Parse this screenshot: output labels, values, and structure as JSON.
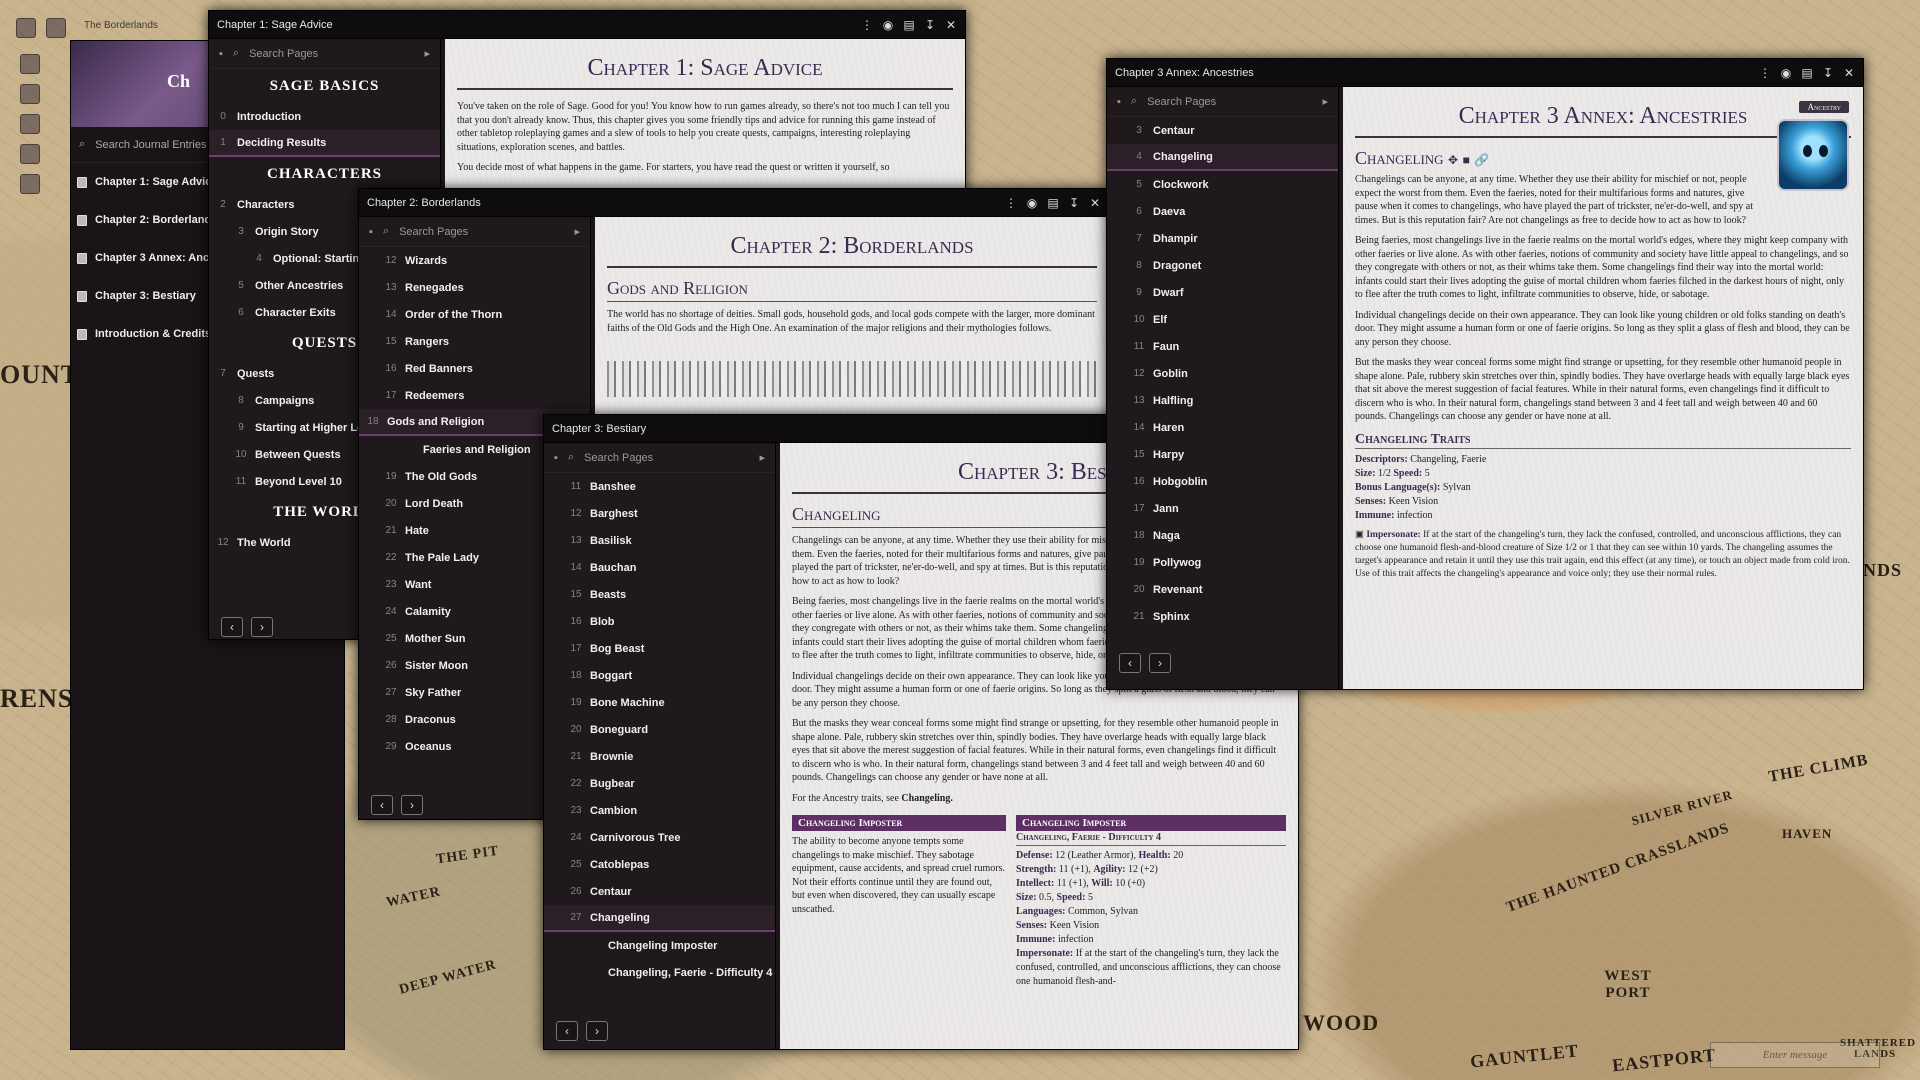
{
  "map": {
    "labels": [
      "OUNT",
      "RENS",
      "THE PIT",
      "WATER",
      "DEEP WATER",
      "N WOOD",
      "GAUNTLET",
      "EASTPORT",
      "WEST PORT",
      "THE HAUNTED CRASSLANDS",
      "SILVER RIVER",
      "HAVEN",
      "THE CLIMB",
      "LANDS",
      "SHATTERED LANDS"
    ]
  },
  "chat": {
    "placeholder": "Enter message"
  },
  "journal": {
    "search_placeholder": "Search Journal Entries",
    "entries": [
      "Chapter 1: Sage Advice",
      "Chapter 2: Borderlands",
      "Chapter 3 Annex: Ancestries",
      "Chapter 3: Bestiary",
      "Introduction & Credits"
    ],
    "banner_title": "Ch",
    "tab_title": "The Borderlands"
  },
  "w1": {
    "title": "Chapter 1: Sage Advice",
    "search": "Search Pages",
    "sections": [
      {
        "heading": "Sage Basics",
        "items": [
          {
            "n": "0",
            "label": "Introduction"
          },
          {
            "n": "1",
            "label": "Deciding Results"
          }
        ]
      },
      {
        "heading": "Characters",
        "items": [
          {
            "n": "2",
            "label": "Characters"
          },
          {
            "n": "3",
            "label": "Origin Story"
          },
          {
            "n": "4",
            "label": "Optional: Starting T"
          },
          {
            "n": "5",
            "label": "Other Ancestries"
          },
          {
            "n": "6",
            "label": "Character Exits"
          }
        ]
      },
      {
        "heading": "Quests",
        "items": [
          {
            "n": "7",
            "label": "Quests"
          },
          {
            "n": "8",
            "label": "Campaigns"
          },
          {
            "n": "9",
            "label": "Starting at Higher Lev"
          },
          {
            "n": "10",
            "label": "Between Quests"
          },
          {
            "n": "11",
            "label": "Beyond Level 10"
          }
        ]
      },
      {
        "heading": "The World",
        "items": [
          {
            "n": "12",
            "label": "The World"
          }
        ]
      }
    ],
    "page_title": "Chapter 1: Sage Advice",
    "p1": "You've taken on the role of Sage. Good for you! You know how to run games already, so there's not too much I can tell you that you don't already know. Thus, this chapter gives you some friendly tips and advice for running this game instead of other tabletop roleplaying games and a slew of tools to help you create quests, campaigns, interesting roleplaying situations, exploration scenes, and battles.",
    "p2": "You decide most of what happens in the game. For starters, you have read the quest or written it yourself, so"
  },
  "w2": {
    "title": "Chapter 2: Borderlands",
    "search": "Search Pages",
    "items": [
      {
        "n": "12",
        "label": "Wizards"
      },
      {
        "n": "13",
        "label": "Renegades"
      },
      {
        "n": "14",
        "label": "Order of the Thorn"
      },
      {
        "n": "15",
        "label": "Rangers"
      },
      {
        "n": "16",
        "label": "Red Banners"
      },
      {
        "n": "17",
        "label": "Redeemers"
      },
      {
        "n": "18",
        "label": "Gods and Religion"
      },
      {
        "n": "",
        "label": "Faeries and Religion"
      },
      {
        "n": "19",
        "label": "The Old Gods"
      },
      {
        "n": "20",
        "label": "Lord Death"
      },
      {
        "n": "21",
        "label": "Hate"
      },
      {
        "n": "22",
        "label": "The Pale Lady"
      },
      {
        "n": "23",
        "label": "Want"
      },
      {
        "n": "24",
        "label": "Calamity"
      },
      {
        "n": "25",
        "label": "Mother Sun"
      },
      {
        "n": "26",
        "label": "Sister Moon"
      },
      {
        "n": "27",
        "label": "Sky Father"
      },
      {
        "n": "28",
        "label": "Draconus"
      },
      {
        "n": "29",
        "label": "Oceanus"
      }
    ],
    "page_title": "Chapter 2: Borderlands",
    "h2": "Gods and Religion",
    "p1": "The world has no shortage of deities. Small gods, household gods, and local gods compete with the larger, more dominant faiths of the Old Gods and the High One. An examination of the major religions and their mythologies follows."
  },
  "w3": {
    "title": "Chapter 3: Bestiary",
    "search": "Search Pages",
    "items": [
      {
        "n": "11",
        "label": "Banshee"
      },
      {
        "n": "12",
        "label": "Barghest"
      },
      {
        "n": "13",
        "label": "Basilisk"
      },
      {
        "n": "14",
        "label": "Bauchan"
      },
      {
        "n": "15",
        "label": "Beasts"
      },
      {
        "n": "16",
        "label": "Blob"
      },
      {
        "n": "17",
        "label": "Bog Beast"
      },
      {
        "n": "18",
        "label": "Boggart"
      },
      {
        "n": "19",
        "label": "Bone Machine"
      },
      {
        "n": "20",
        "label": "Boneguard"
      },
      {
        "n": "21",
        "label": "Brownie"
      },
      {
        "n": "22",
        "label": "Bugbear"
      },
      {
        "n": "23",
        "label": "Cambion"
      },
      {
        "n": "24",
        "label": "Carnivorous Tree"
      },
      {
        "n": "25",
        "label": "Catoblepas"
      },
      {
        "n": "26",
        "label": "Centaur"
      },
      {
        "n": "27",
        "label": "Changeling"
      },
      {
        "n": "",
        "label": "Changeling Imposter"
      },
      {
        "n": "",
        "label": "Changeling, Faerie - Difficulty 4"
      }
    ],
    "page_title": "Chapter 3: Bestia",
    "h2": "Changeling",
    "p1": "Changelings can be anyone, at any time. Whether they use their ability for mischief or not, people expect the worst from them. Even the faeries, noted for their multifarious forms and natures, give pause when it comes to changelings, who have played the part of trickster, ne'er-do-well, and spy at times. But is this reputation fair? Are not changelings as free to decide how to act as how to look?",
    "p2": "Being faeries, most changelings live in the faerie realms on the mortal world's edges, where they might keep company with other faeries or live alone. As with other faeries, notions of community and society have little appeal to changelings, and so they congregate with others or not, as their whims take them. Some changelings find their way into the mortal world: infants could start their lives adopting the guise of mortal children whom faeries filched in the darkest hours of night, only to flee after the truth comes to light, infiltrate communities to observe, hide, or sabotage.",
    "p3": "Individual changelings decide on their own appearance. They can look like young children or old folks standing on death's door. They might assume a human form or one of faerie origins. So long as they split a glass of flesh and blood, they can be any person they choose.",
    "p4": "But the masks they wear conceal forms some might find strange or upsetting, for they resemble other humanoid people in shape alone. Pale, rubbery skin stretches over thin, spindly bodies. They have overlarge heads with equally large black eyes that sit above the merest suggestion of facial features. While in their natural forms, even changelings find it difficult to discern who is who. In their natural form, changelings stand between 3 and 4 feet tall and weigh between 40 and 60 pounds. Changelings can choose any gender or have none at all.",
    "p5a": "For the Ancestry traits, see ",
    "p5b": "Changeling.",
    "box1_title": "Changeling Imposter",
    "box1_text": "The ability to become anyone tempts some changelings to make mischief. They sabotage equipment, cause accidents, and spread cruel rumors. Not their efforts continue until they are found out, but even when discovered, they can usually escape unscathed.",
    "box2_title": "Changeling Imposter",
    "box2_sub": "Changeling, Faerie - Difficulty 4",
    "stats": [
      {
        "k": "Defense:",
        "v": " 12 (Leather Armor), "
      },
      {
        "k": "Health:",
        "v": " 20"
      },
      {
        "k": "Strength:",
        "v": " 11 (+1), "
      },
      {
        "k": "Agility:",
        "v": " 12 (+2)"
      },
      {
        "k": "Intellect:",
        "v": " 11 (+1), "
      },
      {
        "k": "Will:",
        "v": " 10 (+0)"
      },
      {
        "k": "Size:",
        "v": " 0.5, "
      },
      {
        "k": "Speed:",
        "v": " 5"
      },
      {
        "k": "Languages:",
        "v": " Common, Sylvan"
      },
      {
        "k": "Senses:",
        "v": " Keen Vision"
      },
      {
        "k": "Immune:",
        "v": " infection"
      },
      {
        "k": "Impersonate:",
        "v": " If at the start of the changeling's turn, they lack the confused, controlled, and unconscious afflictions, they can choose one humanoid flesh-and-"
      }
    ]
  },
  "w4": {
    "title": "Chapter 3 Annex: Ancestries",
    "search": "Search Pages",
    "items": [
      {
        "n": "3",
        "label": "Centaur"
      },
      {
        "n": "4",
        "label": "Changeling"
      },
      {
        "n": "5",
        "label": "Clockwork"
      },
      {
        "n": "6",
        "label": "Daeva"
      },
      {
        "n": "7",
        "label": "Dhampir"
      },
      {
        "n": "8",
        "label": "Dragonet"
      },
      {
        "n": "9",
        "label": "Dwarf"
      },
      {
        "n": "10",
        "label": "Elf"
      },
      {
        "n": "11",
        "label": "Faun"
      },
      {
        "n": "12",
        "label": "Goblin"
      },
      {
        "n": "13",
        "label": "Halfling"
      },
      {
        "n": "14",
        "label": "Haren"
      },
      {
        "n": "15",
        "label": "Harpy"
      },
      {
        "n": "16",
        "label": "Hobgoblin"
      },
      {
        "n": "17",
        "label": "Jann"
      },
      {
        "n": "18",
        "label": "Naga"
      },
      {
        "n": "19",
        "label": "Pollywog"
      },
      {
        "n": "20",
        "label": "Revenant"
      },
      {
        "n": "21",
        "label": "Sphinx"
      }
    ],
    "page_title": "Chapter 3 Annex: Ancestries",
    "h2": "Changeling",
    "tag": "Ancestry",
    "p1": "Changelings can be anyone, at any time. Whether they use their ability for mischief or not, people expect the worst from them. Even the faeries, noted for their multifarious forms and natures, give pause when it comes to changelings, who have played the part of trickster, ne'er-do-well, and spy at times. But is this reputation fair? Are not changelings as free to decide how to act as how to look?",
    "p2": "Being faeries, most changelings live in the faerie realms on the mortal world's edges, where they might keep company with other faeries or live alone. As with other faeries, notions of community and society have little appeal to changelings, and so they congregate with others or not, as their whims take them. Some changelings find their way into the mortal world: infants could start their lives adopting the guise of mortal children whom faeries filched in the darkest hours of night, only to flee after the truth comes to light, infiltrate communities to observe, hide, or sabotage.",
    "p3": "Individual changelings decide on their own appearance. They can look like young children or old folks standing on death's door. They might assume a human form or one of faerie origins. So long as they split a glass of flesh and blood, they can be any person they choose.",
    "p4": "But the masks they wear conceal forms some might find strange or upsetting, for they resemble other humanoid people in shape alone. Pale, rubbery skin stretches over thin, spindly bodies. They have overlarge heads with equally large black eyes that sit above the merest suggestion of facial features. While in their natural forms, even changelings find it difficult to discern who is who. In their natural form, changelings stand between 3 and 4 feet tall and weigh between 40 and 60 pounds. Changelings can choose any gender or have none at all.",
    "h3": "Changeling Traits",
    "traits": [
      {
        "k": "Descriptors:",
        "v": " Changeling, Faerie"
      },
      {
        "k": "Size:",
        "v": " 1/2 "
      },
      {
        "k": "Speed:",
        "v": " 5"
      },
      {
        "k": "Bonus Language(s):",
        "v": " Sylvan"
      },
      {
        "k": "Senses:",
        "v": " Keen Vision"
      },
      {
        "k": "Immune:",
        "v": " infection"
      }
    ],
    "imp_k": "Impersonate:",
    "imp_v": " If at the start of the changeling's turn, they lack the confused, controlled, and unconscious afflictions, they can choose one humanoid flesh-and-blood creature of Size 1/2 or 1 that they can see within 10 yards. The changeling assumes the target's appearance and retain it until they use this trait again, end this effect (at any time), or touch an object made from cold iron. Use of this trait affects the changeling's appearance and voice only; they use their normal rules."
  }
}
